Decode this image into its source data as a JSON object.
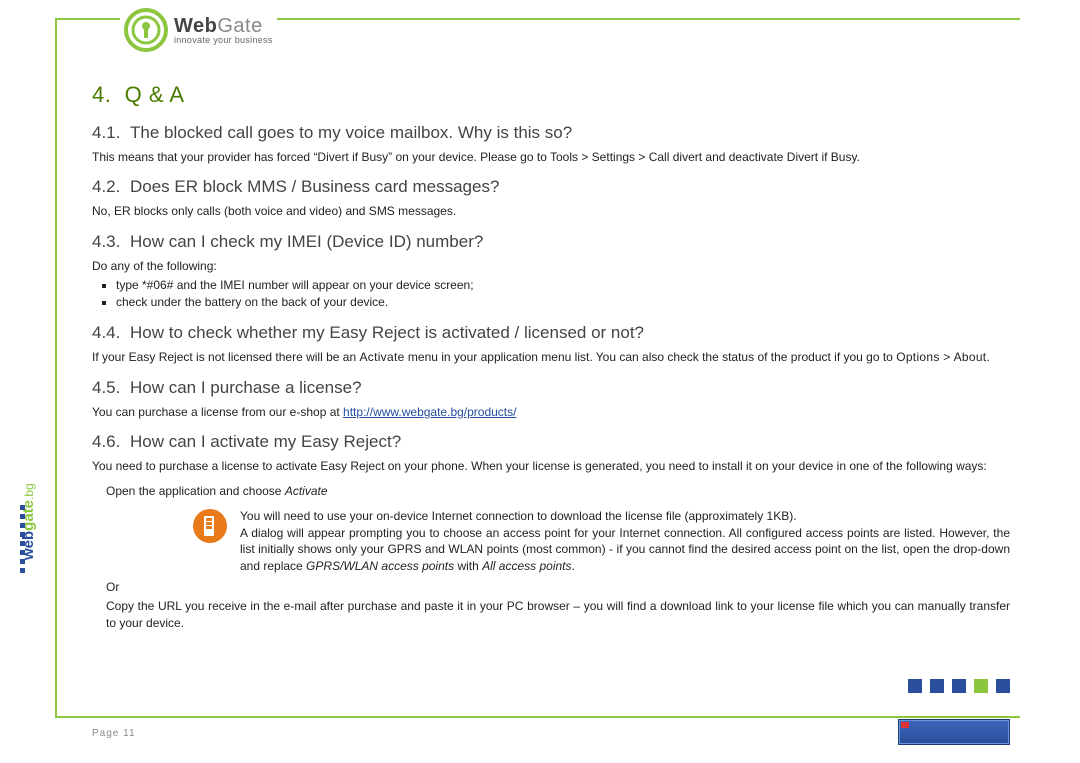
{
  "logo": {
    "brand_main": "Web",
    "brand_sub": "Gate",
    "slogan": "innovate your business"
  },
  "left_tab": {
    "web": "web",
    "gate": "gate",
    "bg": ".bg"
  },
  "h1": {
    "num": "4.",
    "title": "Q & A"
  },
  "s41": {
    "num": "4.1.",
    "title": "The blocked call goes to my voice mailbox. Why is this so?",
    "body": "This means that your provider has forced “Divert if Busy” on your device. Please go to Tools > Settings > Call divert and deactivate Divert if Busy."
  },
  "s42": {
    "num": "4.2.",
    "title": "Does ER block MMS / Business card messages?",
    "body": "No, ER blocks only calls (both voice and video) and SMS messages."
  },
  "s43": {
    "num": "4.3.",
    "title": "How can I check my IMEI (Device ID) number?",
    "intro": "Do any of the following:",
    "b1": "type *#06# and the IMEI number will appear on your device screen;",
    "b2": "check under the battery on the back of your device."
  },
  "s44": {
    "num": "4.4.",
    "title": "How to check whether my Easy Reject is activated / licensed or not?",
    "body_a": "If your Easy Reject is not licensed there will be an ",
    "body_b": "Activate",
    "body_c": " menu in your application menu list. You can also check the status of the product if you go to ",
    "body_d": "Options > About",
    "body_e": "."
  },
  "s45": {
    "num": "4.5.",
    "title": "How can I purchase a license?",
    "body_a": "You can purchase a license from our e-shop at ",
    "link": "http://www.webgate.bg/products/"
  },
  "s46": {
    "num": "4.6.",
    "title": "How can I activate my Easy Reject?",
    "body": "You need to purchase a license to activate Easy Reject on your phone. When your license is generated, you need to install it on your device in one of the following ways:",
    "open_a": "Open the application and choose ",
    "open_b": "Activate",
    "act1": "You will need to use your on-device Internet connection to download the license file (approximately 1KB).",
    "act2_a": "A dialog will appear prompting you to choose an access point for your Internet connection. All configured access points are listed. However, the list initially shows only your GPRS and WLAN points (most common) - if you cannot find the desired access point on the list, open the drop-down and replace ",
    "act2_b": "GPRS/WLAN access points",
    "act2_c": " with ",
    "act2_d": "All access points",
    "act2_e": ".",
    "or": "Or",
    "copy": "Copy the URL you receive in the e-mail after purchase and paste it in your PC browser – you will find a download link to your license file which you can manually transfer to your device."
  },
  "page_label": "Page 11"
}
